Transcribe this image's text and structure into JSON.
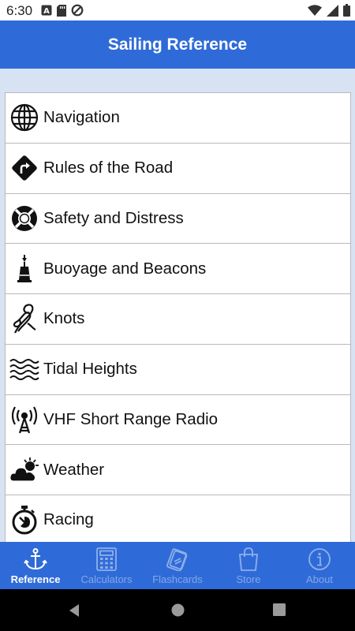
{
  "status_bar": {
    "time": "6:30",
    "icons_left": [
      "text-a-icon",
      "sd-card-icon",
      "do-not-disturb-icon"
    ],
    "icons_right": [
      "wifi-icon",
      "signal-icon",
      "battery-icon"
    ]
  },
  "app_bar": {
    "title": "Sailing Reference"
  },
  "list": {
    "items": [
      {
        "label": "Navigation",
        "icon": "globe-icon"
      },
      {
        "label": "Rules of the Road",
        "icon": "turn-sign-icon"
      },
      {
        "label": "Safety and Distress",
        "icon": "lifebuoy-icon"
      },
      {
        "label": "Buoyage and Beacons",
        "icon": "buoy-icon"
      },
      {
        "label": "Knots",
        "icon": "knot-icon"
      },
      {
        "label": "Tidal Heights",
        "icon": "waves-icon"
      },
      {
        "label": "VHF Short Range Radio",
        "icon": "radio-antenna-icon"
      },
      {
        "label": "Weather",
        "icon": "sun-cloud-icon"
      },
      {
        "label": "Racing",
        "icon": "stopwatch-icon"
      }
    ]
  },
  "bottom_nav": {
    "items": [
      {
        "label": "Reference",
        "icon": "anchor-icon",
        "active": true
      },
      {
        "label": "Calculators",
        "icon": "calculator-icon",
        "active": false
      },
      {
        "label": "Flashcards",
        "icon": "flashcards-icon",
        "active": false
      },
      {
        "label": "Store",
        "icon": "shopping-bag-icon",
        "active": false
      },
      {
        "label": "About",
        "icon": "info-icon",
        "active": false
      }
    ]
  },
  "colors": {
    "primary": "#2f6bd8",
    "content_background": "#d7e2f2",
    "nav_active": "#ffffff",
    "nav_inactive": "#8fb0ea"
  }
}
